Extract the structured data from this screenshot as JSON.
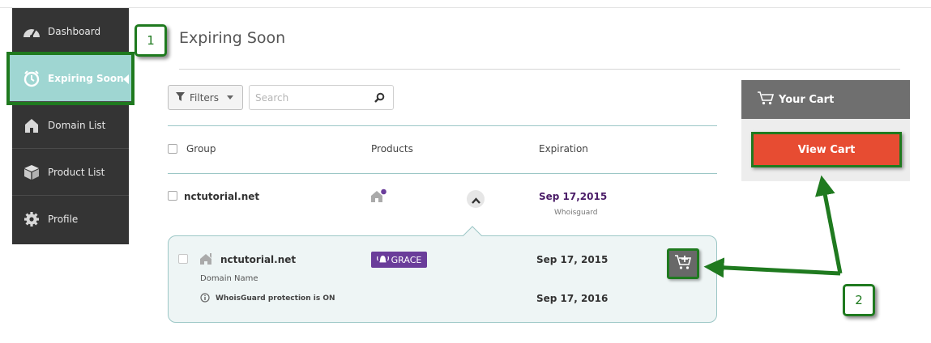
{
  "sidebar": {
    "items": [
      {
        "label": "Dashboard",
        "icon": "speedometer-icon"
      },
      {
        "label": "Expiring Soon",
        "icon": "alarm-clock-icon",
        "active": true
      },
      {
        "label": "Domain List",
        "icon": "house-icon"
      },
      {
        "label": "Product List",
        "icon": "box-icon"
      },
      {
        "label": "Profile",
        "icon": "gear-icon"
      }
    ]
  },
  "callouts": {
    "first": "1",
    "second": "2"
  },
  "page": {
    "title": "Expiring Soon"
  },
  "toolbar": {
    "filters_label": "Filters",
    "search_placeholder": "Search"
  },
  "table": {
    "headers": {
      "group": "Group",
      "products": "Products",
      "expiration": "Expiration"
    },
    "row": {
      "domain": "nctutorial.net",
      "expiration": "Sep 17,2015",
      "expiration_note": "Whoisguard"
    }
  },
  "detail": {
    "domain": "nctutorial.net",
    "type_label": "Domain Name",
    "status_badge": "GRACE",
    "date_primary": "Sep 17, 2015",
    "whoisguard_text": "WhoisGuard protection is ON",
    "date_secondary": "Sep 17, 2016"
  },
  "cart": {
    "title": "Your Cart",
    "button_label": "View Cart"
  },
  "colors": {
    "sidebar_bg": "#343434",
    "active_bg": "#9fd6d2",
    "accent_purple": "#6a3d9a",
    "cart_button": "#e74c32",
    "annotation_green": "#1f7a1f"
  }
}
